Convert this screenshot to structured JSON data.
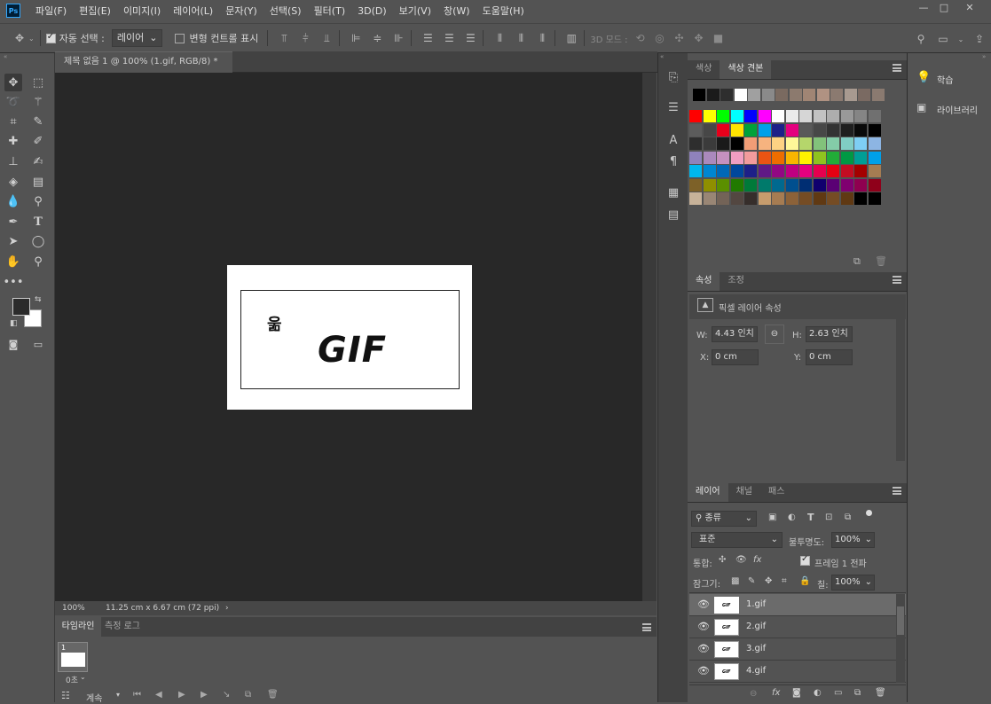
{
  "app": {
    "logo": "Ps"
  },
  "menubar": {
    "items": [
      "파일(F)",
      "편집(E)",
      "이미지(I)",
      "레이어(L)",
      "문자(Y)",
      "선택(S)",
      "필터(T)",
      "3D(D)",
      "보기(V)",
      "창(W)",
      "도움말(H)"
    ],
    "minimize": "—",
    "restore": "□",
    "close": "✕"
  },
  "optionsbar": {
    "auto_select_label": "자동 선택 :",
    "auto_select_value": "레이어",
    "transform_label": "변형 컨트롤 표시",
    "mode_3d_label": "3D 모드 :"
  },
  "document": {
    "tab_title": "제목 없음 1 @ 100% (1.gif, RGB/8) *",
    "canvas_glyph": "욺",
    "canvas_text": "GIF",
    "zoom": "100%",
    "status_info": "11.25 cm x 6.67 cm (72 ppi)"
  },
  "timeline": {
    "tabs": [
      "타임라인",
      "측정 로그"
    ],
    "frame_number": "1",
    "frame_delay": "0초",
    "loop_option": "계속"
  },
  "swatches_panel": {
    "tabs": [
      "색상",
      "색상 견본"
    ],
    "colors": [
      [
        "#ff0000",
        "#ffff00",
        "#00ff00",
        "#00ffff",
        "#0000ff",
        "#ff00ff",
        "#ffffff",
        "#ebebeb",
        "#d6d6d6",
        "#c2c2c2",
        "#adadad",
        "#999999",
        "#858585",
        "#707070"
      ],
      [
        "#5c5c5c",
        "#474747",
        "#e8001b",
        "#ffe400",
        "#00a23a",
        "#00a0e9",
        "#1d2088",
        "#e4007f",
        "#595959",
        "#474747",
        "#333333",
        "#1f1f1f",
        "#0a0a0a",
        "#000000"
      ],
      [
        "#2e2e2e",
        "#3b3b3b",
        "#1a1a1a",
        "#000000",
        "#f19d76",
        "#f6b37f",
        "#fdd283",
        "#fff799",
        "#b5d66b",
        "#82c27b",
        "#84cca8",
        "#80cdc4",
        "#7ecef4",
        "#8db5e3"
      ],
      [
        "#8f82bc",
        "#aa89bd",
        "#c491bf",
        "#f19ec2",
        "#f29b9c",
        "#ea5413",
        "#ed6d00",
        "#f8b500",
        "#fff100",
        "#8fc31f",
        "#22ac38",
        "#009944",
        "#009e96",
        "#00a0e9"
      ],
      [
        "#00b7ee",
        "#0086d1",
        "#0068b7",
        "#00479d",
        "#1d2088",
        "#601986",
        "#920783",
        "#be0081",
        "#e4007f",
        "#e5004f",
        "#e50012",
        "#c30d23",
        "#a40000",
        "#a57c52"
      ],
      [
        "#7d6128",
        "#8f8f00",
        "#5b8f00",
        "#217a00",
        "#007a39",
        "#007a6b",
        "#00698f",
        "#004f8f",
        "#002e73",
        "#10006e",
        "#5a0074",
        "#800070",
        "#8f0050",
        "#8f001a"
      ],
      [
        "#c7b299",
        "#998675",
        "#736357",
        "#534741",
        "#362e2b",
        "#c69c6d",
        "#a67c52",
        "#8c6239",
        "#754c24",
        "#603913",
        "#754c24",
        "#603913",
        "#000000",
        "#000000"
      ]
    ],
    "recent": [
      "#000000",
      "#1b1b1b",
      "#2e2e2e",
      "#ffffff",
      "#a0a0a0",
      "#8a8a8a",
      "#7a6a60",
      "#8c7a6e",
      "#a08574",
      "#b09282",
      "#8b7a70",
      "#a89a90",
      "#7a6a62",
      "#8a7a70"
    ]
  },
  "properties_panel": {
    "tabs": [
      "속성",
      "조정"
    ],
    "title": "픽셀 레이어 속성",
    "w_label": "W:",
    "w_value": "4.43 인치",
    "h_label": "H:",
    "h_value": "2.63 인치",
    "x_label": "X:",
    "x_value": "0 cm",
    "y_label": "Y:",
    "y_value": "0 cm"
  },
  "layers_panel": {
    "tabs": [
      "레이어",
      "채널",
      "패스"
    ],
    "filter_kind": "종류",
    "blend_mode": "표준",
    "opacity_label": "불투명도:",
    "opacity_value": "100%",
    "unify_label": "통합:",
    "propagate_label": "프레임 1 전파",
    "lock_label": "잠그기:",
    "fill_label": "칠:",
    "fill_value": "100%",
    "layers": [
      "1.gif",
      "2.gif",
      "3.gif",
      "4.gif"
    ]
  },
  "learn_panel": {
    "learn_label": "학습",
    "library_label": "라이브러리"
  }
}
